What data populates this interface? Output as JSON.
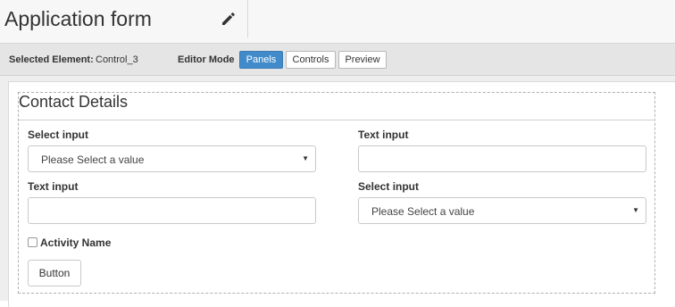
{
  "header": {
    "title": "Application form",
    "edit_icon": "pencil-icon"
  },
  "toolbar": {
    "selected_label": "Selected Element:",
    "selected_value": "Control_3",
    "mode_label": "Editor Mode",
    "modes": [
      "Panels",
      "Controls",
      "Preview"
    ],
    "active_mode": "Panels",
    "accent_color": "#428bca"
  },
  "form": {
    "section_title": "Contact Details",
    "fields": [
      {
        "label": "Select input",
        "type": "select",
        "value": "Please Select a value"
      },
      {
        "label": "Text input",
        "type": "text",
        "value": ""
      },
      {
        "label": "Text input",
        "type": "text",
        "value": ""
      },
      {
        "label": "Select input",
        "type": "select",
        "value": "Please Select a value"
      }
    ],
    "checkbox_label": "Activity Name",
    "checkbox_checked": false,
    "button_label": "Button"
  }
}
